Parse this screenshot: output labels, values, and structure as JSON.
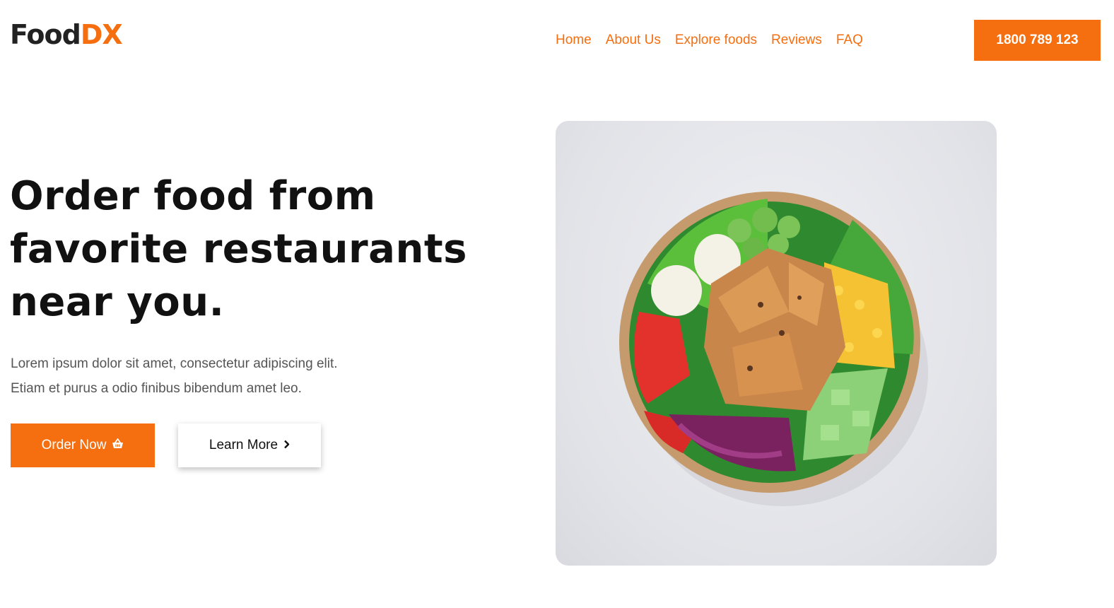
{
  "brand": {
    "name_dark": "Food",
    "name_accent": "DX",
    "accent_color": "#f56e0f"
  },
  "nav": {
    "items": [
      {
        "label": "Home"
      },
      {
        "label": "About Us"
      },
      {
        "label": "Explore foods"
      },
      {
        "label": "Reviews"
      },
      {
        "label": "FAQ"
      }
    ]
  },
  "header": {
    "phone_label": "1800 789 123"
  },
  "hero": {
    "headline_line1": "Order food from",
    "headline_line2": "favorite restaurants",
    "headline_line3": "near you.",
    "text_line1": "Lorem ipsum dolor sit amet, consectetur adipiscing elit.",
    "text_line2": "Etiam et purus a odio finibus bibendum amet leo.",
    "order_label": "Order Now",
    "order_icon": "basket-icon",
    "learn_label": "Learn More",
    "learn_icon": "chevron-right-icon",
    "image": "salad-bowl-image"
  }
}
